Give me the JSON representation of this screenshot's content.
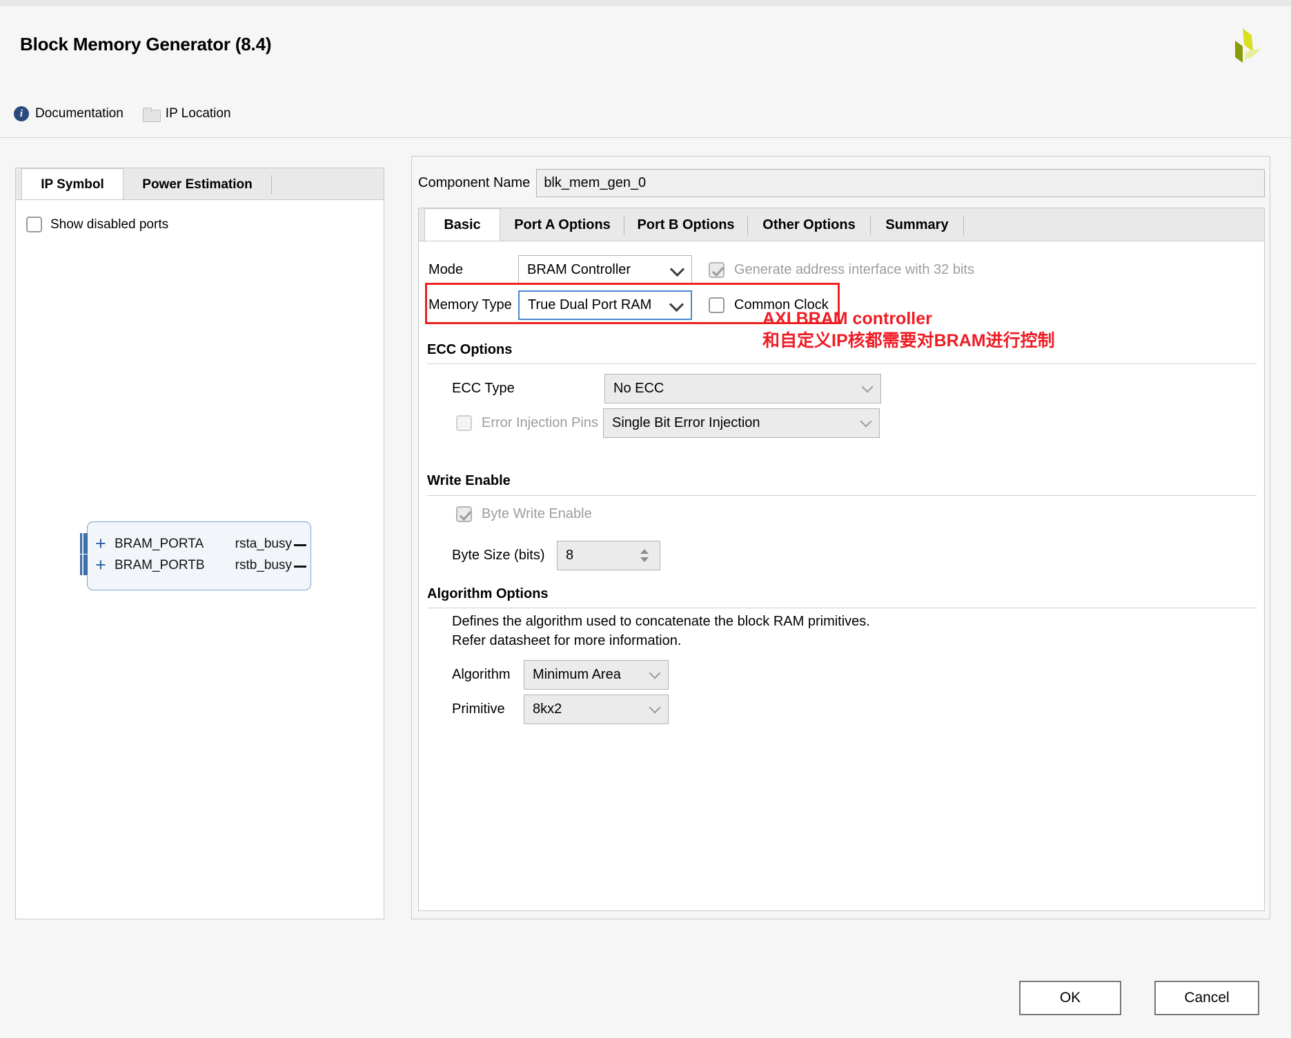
{
  "window": {
    "title": "Block Memory Generator (8.4)",
    "logo_name": "xilinx-logo"
  },
  "toolbar": {
    "documentation": "Documentation",
    "ip_location": "IP Location"
  },
  "left_panel": {
    "tabs": [
      {
        "label": "IP Symbol",
        "active": true
      },
      {
        "label": "Power Estimation",
        "active": false
      }
    ],
    "show_disabled_ports": {
      "label": "Show disabled ports",
      "checked": false
    },
    "symbol": {
      "left_ports": [
        "BRAM_PORTA",
        "BRAM_PORTB"
      ],
      "right_ports": [
        "rsta_busy",
        "rstb_busy"
      ]
    }
  },
  "right_panel": {
    "component_name": {
      "label": "Component Name",
      "value": "blk_mem_gen_0"
    },
    "tabs": [
      {
        "label": "Basic",
        "active": true
      },
      {
        "label": "Port A Options",
        "active": false
      },
      {
        "label": "Port B Options",
        "active": false
      },
      {
        "label": "Other Options",
        "active": false
      },
      {
        "label": "Summary",
        "active": false
      }
    ],
    "basic": {
      "mode": {
        "label": "Mode",
        "value": "BRAM Controller"
      },
      "generate_address_interface": {
        "label": "Generate address interface with 32 bits",
        "checked": true,
        "disabled": true
      },
      "memory_type": {
        "label": "Memory Type",
        "value": "True Dual Port RAM"
      },
      "common_clock": {
        "label": "Common Clock",
        "checked": false
      },
      "ecc_options": {
        "title": "ECC Options",
        "ecc_type": {
          "label": "ECC Type",
          "value": "No ECC"
        },
        "error_injection_pins": {
          "label": "Error Injection Pins",
          "checked": false,
          "disabled": true,
          "value": "Single Bit Error Injection"
        }
      },
      "write_enable": {
        "title": "Write Enable",
        "byte_write_enable": {
          "label": "Byte Write Enable",
          "checked": true,
          "disabled": true
        },
        "byte_size": {
          "label": "Byte Size (bits)",
          "value": "8"
        }
      },
      "algorithm_options": {
        "title": "Algorithm Options",
        "description_line1": "Defines the algorithm used to concatenate the block RAM primitives.",
        "description_line2": "Refer datasheet for more information.",
        "algorithm": {
          "label": "Algorithm",
          "value": "Minimum Area"
        },
        "primitive": {
          "label": "Primitive",
          "value": "8kx2"
        }
      }
    }
  },
  "annotation": {
    "line1": "AXI BRAM controller",
    "line2": "和自定义IP核都需要对BRAM进行控制",
    "color": "#ef1c24"
  },
  "footer": {
    "ok": "OK",
    "cancel": "Cancel"
  }
}
